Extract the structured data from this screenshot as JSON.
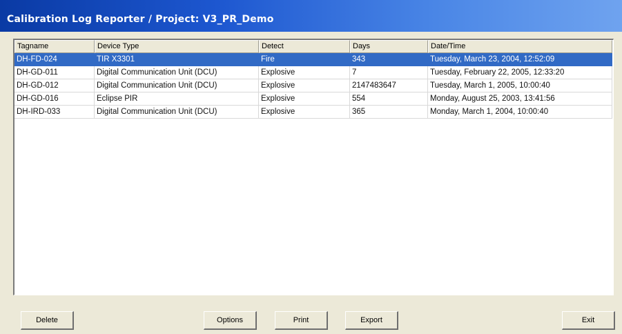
{
  "window": {
    "title": "Calibration Log Reporter / Project: V3_PR_Demo"
  },
  "table": {
    "columns": [
      "Tagname",
      "Device Type",
      "Detect",
      "Days",
      "Date/Time"
    ],
    "selected_row": 0,
    "rows": [
      [
        "DH-FD-024",
        "TIR X3301",
        "Fire",
        "343",
        "Tuesday, March 23, 2004, 12:52:09"
      ],
      [
        "DH-GD-011",
        "Digital Communication Unit (DCU)",
        "Explosive",
        "7",
        "Tuesday, February 22, 2005, 12:33:20"
      ],
      [
        "DH-GD-012",
        "Digital Communication Unit (DCU)",
        "Explosive",
        "2147483647",
        "Tuesday, March 1, 2005, 10:00:40"
      ],
      [
        "DH-GD-016",
        "Eclipse PIR",
        "Explosive",
        "554",
        "Monday, August 25, 2003, 13:41:56"
      ],
      [
        "DH-IRD-033",
        "Digital Communication Unit (DCU)",
        "Explosive",
        "365",
        "Monday, March 1, 2004, 10:00:40"
      ]
    ]
  },
  "buttons": {
    "delete": "Delete",
    "options": "Options",
    "print": "Print",
    "export": "Export",
    "exit": "Exit"
  },
  "colors": {
    "selection": "#316ac5",
    "title_bar": "#1d57d0",
    "face": "#ece9d8"
  }
}
